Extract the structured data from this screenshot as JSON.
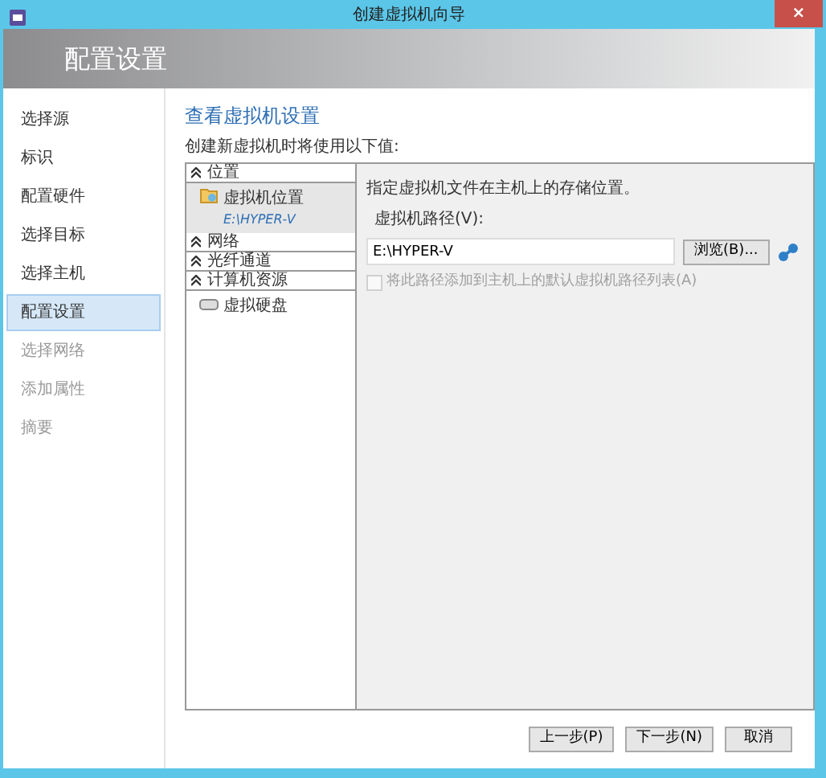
{
  "window": {
    "title": "创建虚拟机向导",
    "close": "×"
  },
  "header": {
    "title": "配置设置"
  },
  "sidebar": {
    "items": [
      {
        "label": "选择源",
        "selected": false,
        "disabled": false
      },
      {
        "label": "标识",
        "selected": false,
        "disabled": false
      },
      {
        "label": "配置硬件",
        "selected": false,
        "disabled": false
      },
      {
        "label": "选择目标",
        "selected": false,
        "disabled": false
      },
      {
        "label": "选择主机",
        "selected": false,
        "disabled": false
      },
      {
        "label": "配置设置",
        "selected": true,
        "disabled": false
      },
      {
        "label": "选择网络",
        "selected": false,
        "disabled": true
      },
      {
        "label": "添加属性",
        "selected": false,
        "disabled": true
      },
      {
        "label": "摘要",
        "selected": false,
        "disabled": true
      }
    ]
  },
  "content": {
    "title": "查看虚拟机设置",
    "subtitle": "创建新虚拟机时将使用以下值:"
  },
  "tree": [
    {
      "label": "位置",
      "expanded": true,
      "children": [
        {
          "kind": "folder",
          "label": "虚拟机位置",
          "detail": "E:\\HYPER-V",
          "selected": true
        }
      ]
    },
    {
      "label": "网络",
      "expanded": true
    },
    {
      "label": "光纤通道",
      "expanded": true
    },
    {
      "label": "计算机资源",
      "expanded": true,
      "children": [
        {
          "kind": "disk",
          "label": "虚拟硬盘",
          "selected": false
        }
      ]
    }
  ],
  "details": {
    "description": "指定虚拟机文件在主机上的存储位置。",
    "path_label": "虚拟机路径(V):",
    "path_value": "E:\\HYPER-V",
    "browse_button": "浏览(B)...",
    "checkbox": {
      "label": "将此路径添加到主机上的默认虚拟机路径列表(A)",
      "checked": false,
      "disabled": true
    }
  },
  "buttons": [
    {
      "label": "上一步(P)"
    },
    {
      "label": "下一步(N)"
    },
    {
      "label": "取消"
    }
  ]
}
